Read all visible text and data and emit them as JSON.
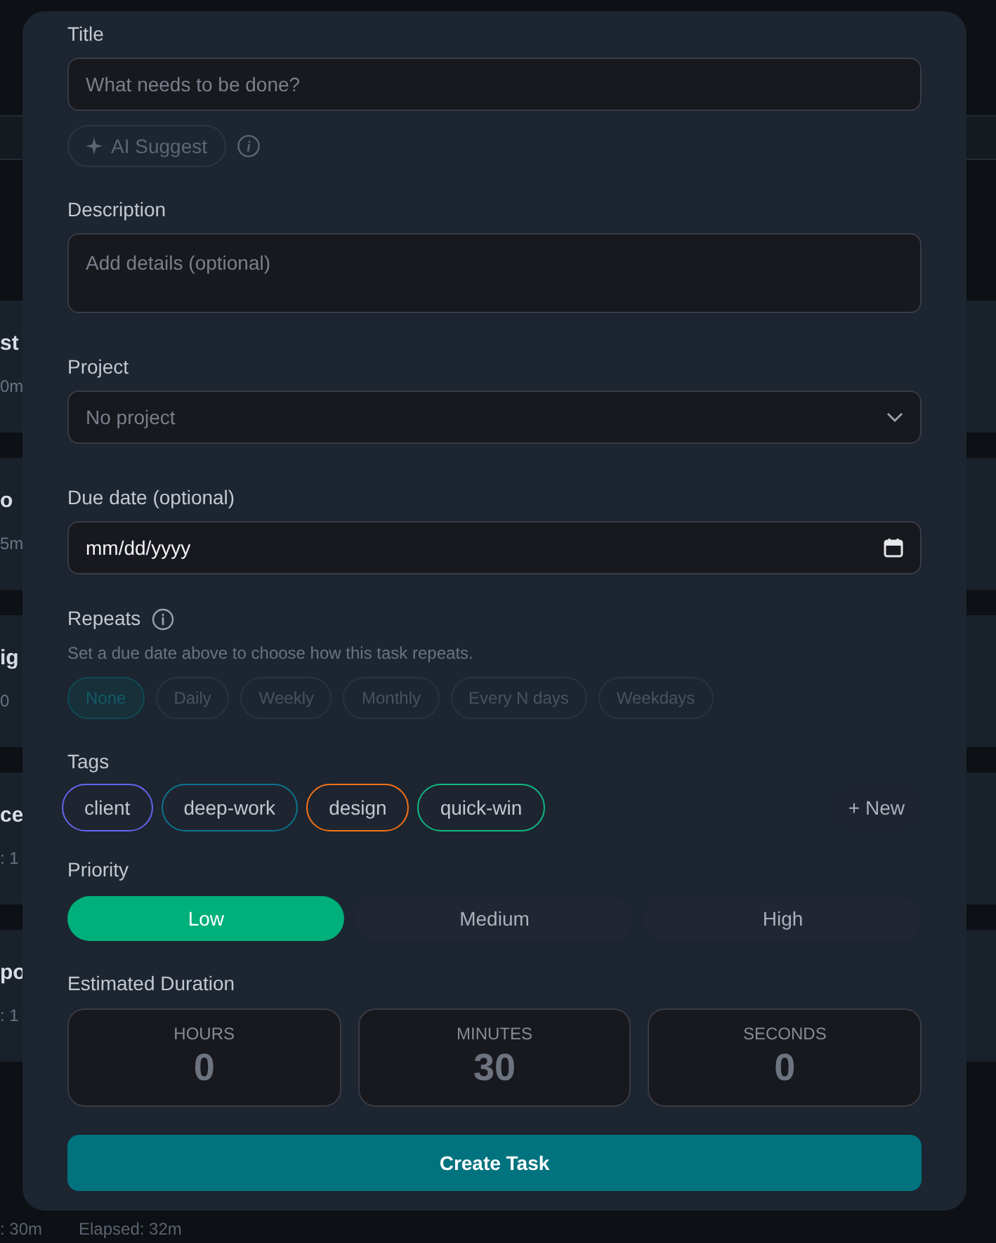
{
  "background": {
    "cards": [
      {
        "title": "st",
        "meta": "0m"
      },
      {
        "title": "o",
        "meta": "5m"
      },
      {
        "title": "ig",
        "meta": "0"
      },
      {
        "title": "ce",
        "meta": ": 1"
      },
      {
        "title": "po",
        "meta": ": 1"
      }
    ],
    "footer": [
      ": 30m",
      "Elapsed: 32m"
    ]
  },
  "form": {
    "title_field": {
      "label": "Title",
      "placeholder": "What needs to be done?"
    },
    "ai_suggest": {
      "label": "AI Suggest",
      "disabled": true
    },
    "description": {
      "label": "Description",
      "placeholder": "Add details (optional)"
    },
    "project": {
      "label": "Project",
      "value": "No project"
    },
    "due_date": {
      "label": "Due date (optional)",
      "value": "mm/dd/yyyy"
    },
    "repeats": {
      "label": "Repeats",
      "hint": "Set a due date above to choose how this task repeats.",
      "disabled": true,
      "options": [
        {
          "label": "None",
          "selected": true
        },
        {
          "label": "Daily",
          "selected": false
        },
        {
          "label": "Weekly",
          "selected": false
        },
        {
          "label": "Monthly",
          "selected": false
        },
        {
          "label": "Every N days",
          "selected": false
        },
        {
          "label": "Weekdays",
          "selected": false
        }
      ]
    },
    "tags": {
      "label": "Tags",
      "items": [
        {
          "label": "client",
          "color": "#6366f1"
        },
        {
          "label": "deep-work",
          "color": "#0e7490"
        },
        {
          "label": "design",
          "color": "#f97316"
        },
        {
          "label": "quick-win",
          "color": "#10b981"
        }
      ],
      "new_button": "+ New"
    },
    "priority": {
      "label": "Priority",
      "options": [
        {
          "label": "Low",
          "selected": true
        },
        {
          "label": "Medium",
          "selected": false
        },
        {
          "label": "High",
          "selected": false
        }
      ]
    },
    "duration": {
      "label": "Estimated Duration",
      "fields": [
        {
          "label": "HOURS",
          "value": "0"
        },
        {
          "label": "MINUTES",
          "value": "30"
        },
        {
          "label": "SECONDS",
          "value": "0"
        }
      ]
    },
    "submit": "Create Task"
  }
}
